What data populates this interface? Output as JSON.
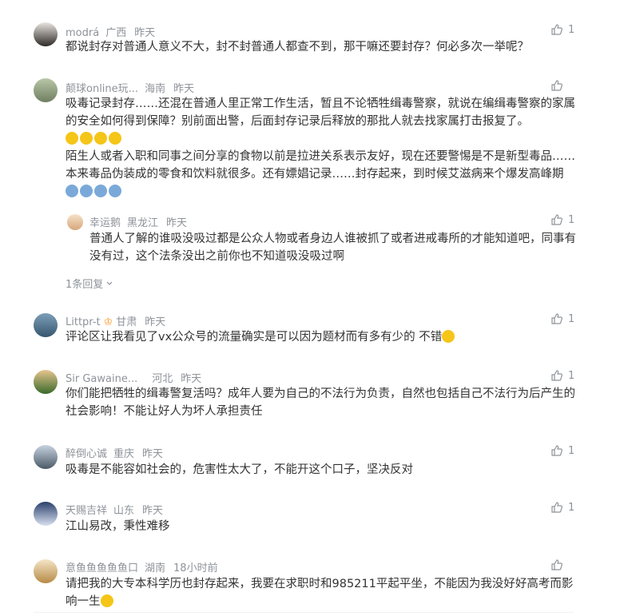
{
  "comments": [
    {
      "user": "modrá",
      "loc": "广西",
      "time": "昨天",
      "likes": "1",
      "text": "都说封存对普通人意义不大，封不封普通人都查不到，那干嘛还要封存？何必多次一举呢？"
    },
    {
      "user": "颠球online玩...",
      "loc": "海南",
      "time": "昨天",
      "likes": "",
      "text1": "吸毒记录封存……还混在普通人里正常工作生活，暂且不论牺牲缉毒警察，就说在编缉毒警察的家属的安全如何得到保障？别前面出警，后面封存记录后释放的那批人就去找家属打击报复了。",
      "text2": "陌生人或者入职和同事之间分享的食物以前是拉进关系表示友好，现在还要警惕是不是新型毒品……本来毒品伪装成的零食和饮料就很多。还有嫖娼记录……封存起来，到时候艾滋病来个爆发高峰期",
      "reply": {
        "user": "幸运鹅",
        "loc": "黑龙江",
        "time": "昨天",
        "likes": "1",
        "text": "普通人了解的谁吸没吸过都是公众人物或者身边人谁被抓了或者进戒毒所的才能知道吧，同事有没有过，这个法条没出之前你也不知道吸没吸过啊"
      },
      "reply_count": "1条回复"
    },
    {
      "user": "Littpr-t",
      "badge": "♔",
      "loc": "甘肃",
      "time": "昨天",
      "likes": "1",
      "text": "评论区让我看见了vx公众号的流量确实是可以因为题材而有多有少的 不错"
    },
    {
      "user": "Sir Gawaine...",
      "loc": "河北",
      "time": "昨天",
      "likes": "1",
      "text": "你们能把牺牲的缉毒警复活吗？成年人要为自己的不法行为负责，自然也包括自己不法行为后产生的社会影响！不能让好人为坏人承担责任"
    },
    {
      "user": "醉倒心诚",
      "loc": "重庆",
      "time": "昨天",
      "likes": "1",
      "text": "吸毒是不能容如社会的，危害性太大了，不能开这个口子，坚决反对"
    },
    {
      "user": "天赐吉祥",
      "loc": "山东",
      "time": "昨天",
      "likes": "1",
      "text": "江山易改，秉性难移"
    },
    {
      "user": "意鱼鱼鱼鱼鱼口",
      "loc": "湖南",
      "time": "18小时前",
      "likes": "",
      "text": "请把我的大专本科学历也封存起来，我要在求职时和985211平起平坐，不能因为我没好好高考而影响一生"
    }
  ],
  "colors": {
    "meta": "#8e939a",
    "text": "#333333",
    "badge": "#ff9c31"
  },
  "icons": {
    "like": "thumbs-up-icon",
    "emoji_cry": "crying-emoji",
    "emoji_scream": "scream-emoji",
    "emoji_smile": "smile-emoji",
    "chevron": "chevron-down-icon"
  }
}
